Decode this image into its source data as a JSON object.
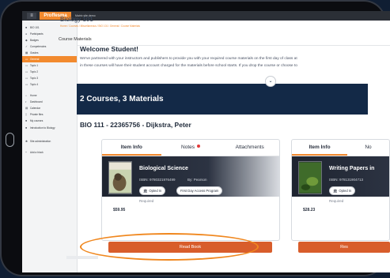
{
  "topbar": {
    "brand": "Proffesma",
    "site_name": "Matrix site demo",
    "menu_icon": "hamburger-icon"
  },
  "sidebar": {
    "items": [
      {
        "label": "BIO 101",
        "icon": "cap-icon"
      },
      {
        "label": "Participants",
        "icon": "users-icon"
      },
      {
        "label": "Badges",
        "icon": "badge-icon"
      },
      {
        "label": "Competencies",
        "icon": "check-icon"
      },
      {
        "label": "Grades",
        "icon": "grid-icon"
      },
      {
        "label": "General",
        "icon": "folder-icon",
        "active": true
      },
      {
        "label": "Topic 1",
        "icon": "folder-icon"
      },
      {
        "label": "Topic 2",
        "icon": "folder-icon"
      },
      {
        "label": "Topic 3",
        "icon": "folder-icon"
      },
      {
        "label": "Topic 4",
        "icon": "folder-icon"
      }
    ],
    "items2": [
      {
        "label": "Home",
        "icon": "home-icon"
      },
      {
        "label": "Dashboard",
        "icon": "dashboard-icon"
      },
      {
        "label": "Calendar",
        "icon": "calendar-icon"
      },
      {
        "label": "Private files",
        "icon": "file-icon"
      },
      {
        "label": "My courses",
        "icon": "cap-icon"
      },
      {
        "label": "Introduction to Biology",
        "icon": "cap-icon"
      }
    ],
    "items3": [
      {
        "label": "Site administration",
        "icon": "gear-icon"
      },
      {
        "label": "Add a block",
        "icon": "plus-icon"
      }
    ]
  },
  "header": {
    "course_title": "Biology 101",
    "breadcrumbs": "Home / Courses / Miscellaneous / BIO 101 / General / Course Materials"
  },
  "section_label": "Course Materials",
  "welcome": {
    "title": "Welcome Student!",
    "line1": "We've partnered with your instructors and publishers to provide you with your required course materials on the first day of class at",
    "line2": "in these courses will have their student account charged for the materials before school starts. If you drop the course or choose to"
  },
  "summary": "2 Courses, 3 Materials",
  "course_heading": "BIO 111 - 22365756 - Dijkstra, Peter",
  "card1": {
    "tabs": [
      "Item Info",
      "Notes",
      "Attachments"
    ],
    "book_title": "Biological Science",
    "isbn": "ISBN: 9780321976499",
    "publisher": "By: Pearson",
    "pill1": "Opted In",
    "pill2": "First Day Access Program",
    "required": "Required",
    "price": "$59.95",
    "button": "Read Book"
  },
  "card2": {
    "tabs": [
      "Item Info",
      "No"
    ],
    "book_title": "Writing Papers in",
    "isbn": "ISBN: 978131904713",
    "pill1": "Opted In",
    "required": "Required",
    "price": "$28.23",
    "button": "Res"
  },
  "colors": {
    "accent": "#f28a2e",
    "button": "#d85d2b",
    "banner": "#132947"
  }
}
